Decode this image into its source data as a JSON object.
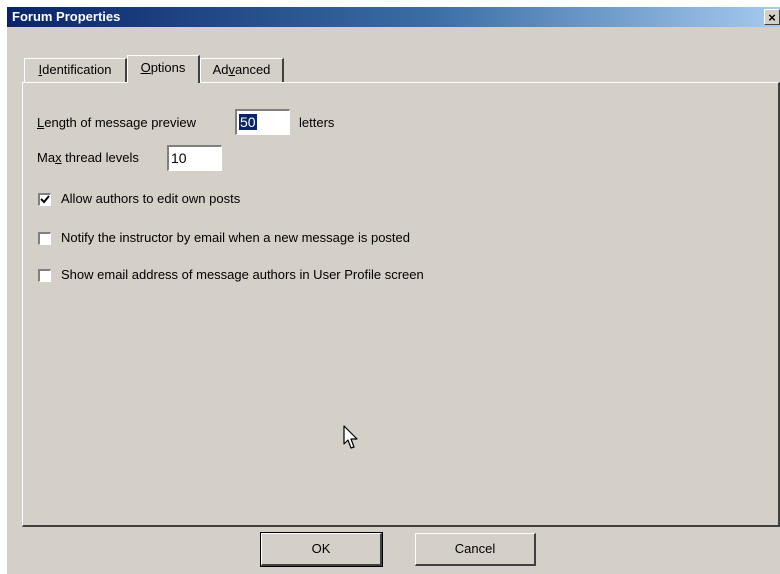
{
  "window": {
    "title": "Forum Properties",
    "close_symbol": "×"
  },
  "tabs": [
    {
      "label": "Identification",
      "accel": "I",
      "rest": "dentification",
      "active": false
    },
    {
      "label": "Options",
      "accel": "O",
      "rest": "ptions",
      "active": true
    },
    {
      "label": "Advanced",
      "pre": "Ad",
      "accel": "v",
      "rest": "anced",
      "active": false
    }
  ],
  "options": {
    "preview_label_accel": "L",
    "preview_label_rest": "ength of message preview",
    "preview_value": "50",
    "preview_unit": "letters",
    "thread_label_pre": "Ma",
    "thread_label_accel": "x",
    "thread_label_rest": " thread levels",
    "thread_value": "10",
    "checkboxes": [
      {
        "label": "Allow authors to edit own posts",
        "checked": true
      },
      {
        "label": "Notify the instructor by email when a new message is posted",
        "checked": false
      },
      {
        "label": "Show email address of message authors in User Profile screen",
        "checked": false
      }
    ]
  },
  "buttons": {
    "ok": "OK",
    "cancel": "Cancel"
  }
}
